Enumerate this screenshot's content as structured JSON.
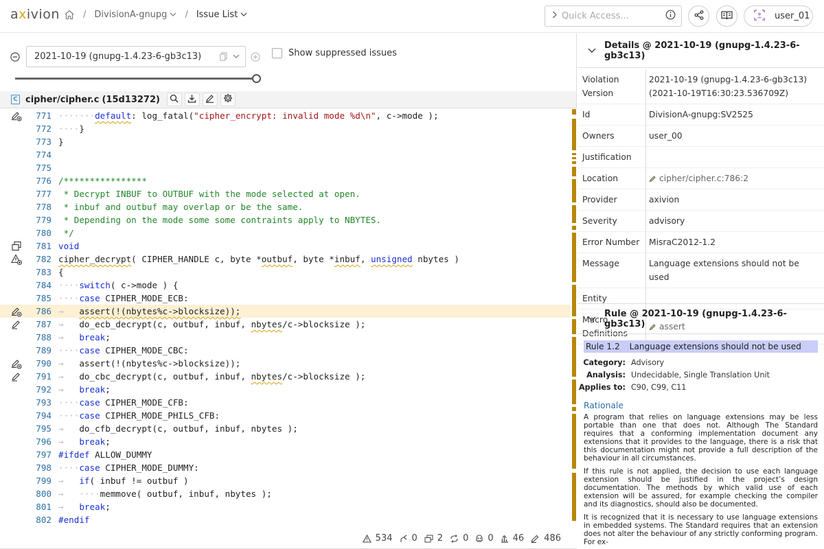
{
  "app": {
    "logo_left": "a",
    "logo_mid": "x",
    "logo_right": "ivion"
  },
  "breadcrumb": {
    "project": "DivisionA-gnupg",
    "page": "Issue List"
  },
  "quick_access": {
    "placeholder": "Quick Access..."
  },
  "user": {
    "name": "user_01"
  },
  "version": {
    "selected": "2021-10-19 (gnupg-1.4.23-6-gb3c13)",
    "show_suppressed": "Show suppressed issues",
    "show_suppressed_checked": false
  },
  "file": {
    "path": "cipher/cipher.c",
    "hash": "(15d13272)",
    "icon_letter": "C"
  },
  "code": [
    {
      "n": "771",
      "g": "violation-add",
      "t": [
        [
          "ws",
          "····"
        ],
        [
          "ws",
          "···"
        ],
        [
          "kw sq",
          "default"
        ],
        [
          "",
          ": log_fatal("
        ],
        [
          "st",
          "\"cipher_encrypt: invalid mode %d\\n\""
        ],
        [
          "",
          ", c->mode );"
        ]
      ]
    },
    {
      "n": "772",
      "g": "",
      "t": [
        [
          "ws",
          "····"
        ],
        [
          "",
          "}"
        ]
      ]
    },
    {
      "n": "773",
      "g": "",
      "t": [
        [
          "",
          "}"
        ]
      ]
    },
    {
      "n": "774",
      "g": "",
      "t": []
    },
    {
      "n": "775",
      "g": "",
      "t": []
    },
    {
      "n": "776",
      "g": "",
      "t": [
        [
          "cm",
          "/****************"
        ]
      ]
    },
    {
      "n": "777",
      "g": "",
      "t": [
        [
          "cm",
          " * Decrypt INBUF to OUTBUF with the mode selected at open."
        ]
      ]
    },
    {
      "n": "778",
      "g": "",
      "t": [
        [
          "cm",
          " * inbuf and outbuf may overlap or be the same."
        ]
      ]
    },
    {
      "n": "779",
      "g": "",
      "t": [
        [
          "cm",
          " * Depending on the mode some some contraints apply to NBYTES."
        ]
      ]
    },
    {
      "n": "780",
      "g": "",
      "t": [
        [
          "cm",
          " */"
        ]
      ]
    },
    {
      "n": "781",
      "g": "copy",
      "t": [
        [
          "kw",
          "void"
        ]
      ]
    },
    {
      "n": "782",
      "g": "warn-add",
      "t": [
        [
          "sq",
          "cipher_decrypt"
        ],
        [
          "",
          "( CIPHER_HANDLE c, byte *"
        ],
        [
          "sq",
          "outbuf"
        ],
        [
          "",
          ", byte *"
        ],
        [
          "sq",
          "inbuf"
        ],
        [
          "",
          ", "
        ],
        [
          "kw sq",
          "unsigned"
        ],
        [
          "",
          " nbytes )"
        ]
      ]
    },
    {
      "n": "783",
      "g": "",
      "t": [
        [
          "",
          "{"
        ]
      ]
    },
    {
      "n": "784",
      "g": "",
      "t": [
        [
          "ws",
          "····"
        ],
        [
          "kw",
          "switch"
        ],
        [
          "",
          "( c->mode ) {"
        ]
      ]
    },
    {
      "n": "785",
      "g": "",
      "t": [
        [
          "ws",
          "····"
        ],
        [
          "kw",
          "case"
        ],
        [
          "",
          " CIPHER_MODE_ECB:"
        ]
      ]
    },
    {
      "n": "786",
      "g": "violation-add",
      "hl": true,
      "t": [
        [
          "ws",
          "→   "
        ],
        [
          "sq",
          "assert(!(nbytes%c->blocksize));"
        ]
      ]
    },
    {
      "n": "787",
      "g": "pencil",
      "t": [
        [
          "ws",
          "→   "
        ],
        [
          "",
          "do_ecb_decrypt(c, outbuf, inbuf, "
        ],
        [
          "sq",
          "nbytes"
        ],
        [
          "",
          "/c->blocksize );"
        ]
      ]
    },
    {
      "n": "788",
      "g": "",
      "t": [
        [
          "ws",
          "→   "
        ],
        [
          "kw",
          "break"
        ],
        [
          "",
          ";"
        ]
      ]
    },
    {
      "n": "789",
      "g": "",
      "t": [
        [
          "ws",
          "····"
        ],
        [
          "kw",
          "case"
        ],
        [
          "",
          " CIPHER_MODE_CBC:"
        ]
      ]
    },
    {
      "n": "790",
      "g": "violation-add",
      "t": [
        [
          "ws",
          "→   "
        ],
        [
          "",
          "assert(!(nbytes%c->blocksize));"
        ]
      ]
    },
    {
      "n": "791",
      "g": "pencil",
      "t": [
        [
          "ws",
          "→   "
        ],
        [
          "",
          "do_cbc_decrypt(c, outbuf, inbuf, "
        ],
        [
          "sq",
          "nbytes"
        ],
        [
          "",
          "/c->blocksize );"
        ]
      ]
    },
    {
      "n": "792",
      "g": "",
      "t": [
        [
          "ws",
          "→   "
        ],
        [
          "kw",
          "break"
        ],
        [
          "",
          ";"
        ]
      ]
    },
    {
      "n": "793",
      "g": "",
      "t": [
        [
          "ws",
          "····"
        ],
        [
          "kw",
          "case"
        ],
        [
          "",
          " CIPHER_MODE_CFB:"
        ]
      ]
    },
    {
      "n": "794",
      "g": "",
      "t": [
        [
          "ws",
          "····"
        ],
        [
          "kw",
          "case"
        ],
        [
          "",
          " CIPHER_MODE_PHILS_CFB:"
        ]
      ]
    },
    {
      "n": "795",
      "g": "",
      "t": [
        [
          "ws",
          "→   "
        ],
        [
          "",
          "do_cfb_decrypt(c, outbuf, inbuf, nbytes );"
        ]
      ]
    },
    {
      "n": "796",
      "g": "",
      "t": [
        [
          "ws",
          "→   "
        ],
        [
          "kw",
          "break"
        ],
        [
          "",
          ";"
        ]
      ]
    },
    {
      "n": "797",
      "g": "",
      "t": [
        [
          "kw",
          "#ifdef"
        ],
        [
          "",
          " ALLOW_DUMMY"
        ]
      ]
    },
    {
      "n": "798",
      "g": "",
      "t": [
        [
          "ws",
          "····"
        ],
        [
          "kw",
          "case"
        ],
        [
          "",
          " CIPHER_MODE_DUMMY:"
        ]
      ]
    },
    {
      "n": "799",
      "g": "",
      "t": [
        [
          "ws",
          "→   "
        ],
        [
          "kw",
          "if"
        ],
        [
          "",
          "( inbuf != outbuf )"
        ]
      ]
    },
    {
      "n": "800",
      "g": "",
      "t": [
        [
          "ws",
          "→   ····"
        ],
        [
          "",
          "memmove( outbuf, inbuf, nbytes );"
        ]
      ]
    },
    {
      "n": "801",
      "g": "",
      "t": [
        [
          "ws",
          "→   "
        ],
        [
          "kw",
          "break"
        ],
        [
          "",
          ";"
        ]
      ]
    },
    {
      "n": "802",
      "g": "",
      "t": [
        [
          "kw",
          "#endif"
        ]
      ]
    }
  ],
  "status": [
    {
      "icon": "warning-icon",
      "value": "534"
    },
    {
      "icon": "branch-icon",
      "value": "0"
    },
    {
      "icon": "clone-icon",
      "value": "2"
    },
    {
      "icon": "cycle-icon",
      "value": "0"
    },
    {
      "icon": "dead-code-icon",
      "value": "0"
    },
    {
      "icon": "metric-icon",
      "value": "46"
    },
    {
      "icon": "style-violation-icon",
      "value": "486"
    }
  ],
  "details": {
    "title": "Details @ 2021-10-19 (gnupg-1.4.23-6-gb3c13)",
    "rows": [
      {
        "k": "Violation Version",
        "v": "2021-10-19 (gnupg-1.4.23-6-gb3c13) (2021-10-19T16:30:23.536709Z)"
      },
      {
        "k": "Id",
        "v": "DivisionA-gnupg:SV2525"
      },
      {
        "k": "Owners",
        "v": "user_00"
      },
      {
        "k": "Justification",
        "v": ""
      },
      {
        "k": "Location",
        "v": "cipher/cipher.c:786:2",
        "link": true
      },
      {
        "k": "Provider",
        "v": "axivion"
      },
      {
        "k": "Severity",
        "v": "advisory"
      },
      {
        "k": "Error Number",
        "v": "MisraC2012-1.2"
      },
      {
        "k": "Message",
        "v": "Language extensions should not be used"
      },
      {
        "k": "Entity",
        "v": ""
      },
      {
        "k": "Macro Definitions",
        "v": "assert",
        "link": true
      }
    ]
  },
  "rule": {
    "title": "Rule @ 2021-10-19 (gnupg-1.4.23-6-gb3c13)",
    "number": "Rule 1.2",
    "name": "Language extensions should not be used",
    "meta": [
      {
        "k": "Category:",
        "v": "Advisory"
      },
      {
        "k": "Analysis:",
        "v": "Undecidable, Single Translation Unit"
      },
      {
        "k": "Applies to:",
        "v": "C90, C99, C11"
      }
    ],
    "rationale_heading": "Rationale",
    "paragraphs": [
      "A program that relies on language extensions may be less portable than one that does not. Although The Standard requires that a conforming implementation document any extensions that it provides to the language, there is a risk that this documentation might not provide a full description of the behaviour in all circumstances.",
      "If this rule is not applied, the decision to use each language extension should be justified in the project’s design documentation. The methods by which valid use of each extension will be assured, for example checking the compiler and its diagnostics, should also be documented.",
      "It is recognized that it is necessary to use language extensions in embedded systems. The Standard requires that an extension does not alter the behaviour of any strictly conforming program. For ex-"
    ]
  },
  "colors": {
    "accent": "#e0a31a",
    "link": "#2a6fa8",
    "highlight_line": "#fdf0d4",
    "rule_title_bg": "#c9cdf7",
    "scroll_marker": "#b8860b"
  }
}
